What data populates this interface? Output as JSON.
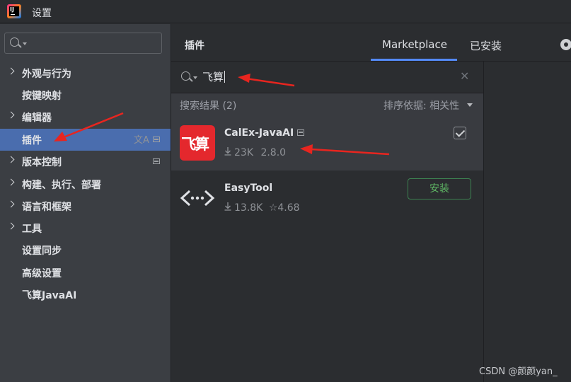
{
  "window": {
    "title": "设置"
  },
  "sidebar": {
    "search_placeholder": "",
    "items": [
      {
        "label": "外观与行为",
        "expandable": true
      },
      {
        "label": "按键映射",
        "expandable": false
      },
      {
        "label": "编辑器",
        "expandable": true
      },
      {
        "label": "插件",
        "expandable": false,
        "active": true
      },
      {
        "label": "版本控制",
        "expandable": true
      },
      {
        "label": "构建、执行、部署",
        "expandable": true
      },
      {
        "label": "语言和框架",
        "expandable": true
      },
      {
        "label": "工具",
        "expandable": true
      },
      {
        "label": "设置同步",
        "expandable": false
      },
      {
        "label": "高级设置",
        "expandable": false
      },
      {
        "label": "飞算JavaAI",
        "expandable": false
      }
    ]
  },
  "header": {
    "title": "插件",
    "tabs": [
      {
        "label": "Marketplace",
        "active": true
      },
      {
        "label": "已安装",
        "active": false
      }
    ]
  },
  "plugin_search": {
    "value": "飞算"
  },
  "results": {
    "count_label": "搜索结果 (2)",
    "sort_label": "排序依据: 相关性"
  },
  "plugins": [
    {
      "name": "CalEx-JavaAI",
      "logo_text": "飞算",
      "downloads": "23K",
      "version": "2.8.0",
      "installed": true
    },
    {
      "name": "EasyTool",
      "downloads": "13.8K",
      "rating": "4.68",
      "action_label": "安装"
    }
  ],
  "watermark": "CSDN @颜颜yan_",
  "colors": {
    "accent": "#548af7",
    "selection": "#4a6dae",
    "annotation_arrow": "#e8251f",
    "install_green": "#5fb865",
    "calex_red": "#e4282d"
  }
}
